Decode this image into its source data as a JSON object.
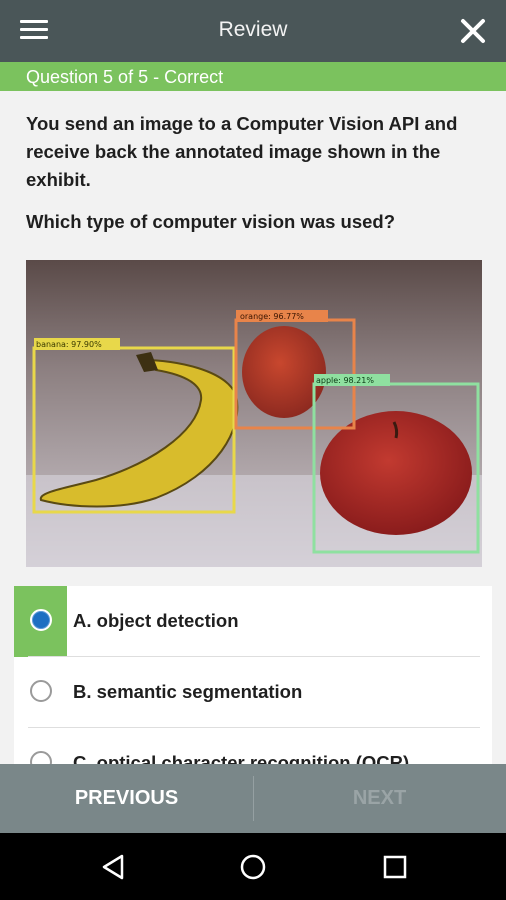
{
  "header": {
    "title": "Review",
    "menu_icon": "hamburger-icon",
    "close_icon": "close-icon"
  },
  "status": {
    "text": "Question 5 of 5 - Correct",
    "color": "#7bc25e"
  },
  "question": {
    "text": "You send an image to a Computer Vision API and receive back the annotated image shown in the exhibit.",
    "prompt": "Which type of computer vision was used?"
  },
  "exhibit": {
    "labels": {
      "banana": "banana: 97.90%",
      "orange": "orange: 96.77%",
      "apple": "apple: 98.21%"
    }
  },
  "answers": [
    {
      "label": "A. object detection",
      "selected": true
    },
    {
      "label": "B. semantic segmentation",
      "selected": false
    },
    {
      "label": "C. optical character recognition (OCR)",
      "selected": false
    }
  ],
  "footer": {
    "previous": "PREVIOUS",
    "next": "NEXT"
  },
  "navbar": {
    "back_icon": "back-triangle-icon",
    "home_icon": "home-circle-icon",
    "recents_icon": "recents-square-icon"
  }
}
